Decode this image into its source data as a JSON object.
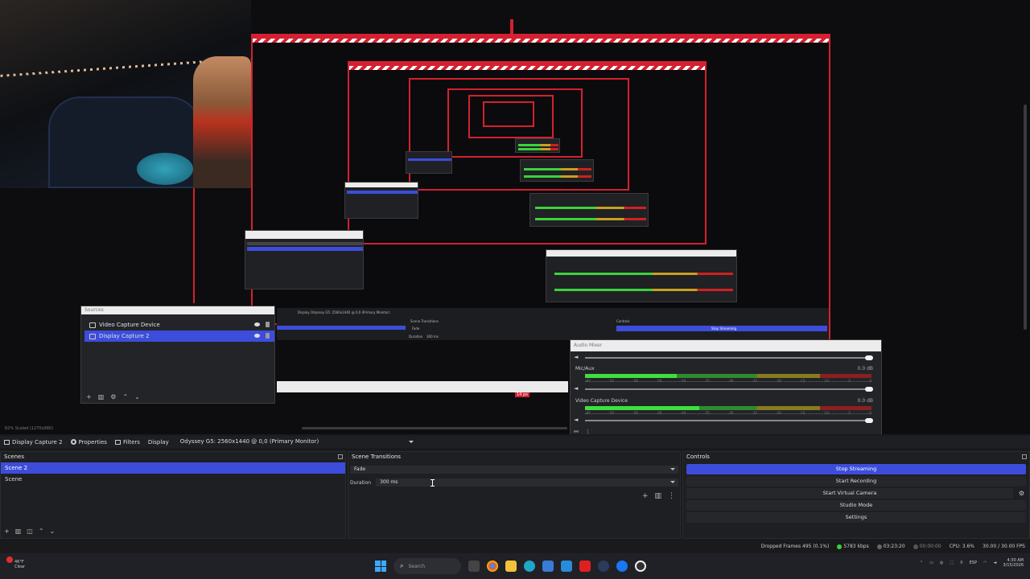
{
  "preview": {
    "sources_window": {
      "title": "Sources",
      "items": [
        {
          "label": "Video Capture Device",
          "selected": false
        },
        {
          "label": "Display Capture 2",
          "selected": true
        }
      ]
    },
    "audio_window": {
      "title": "Audio Mixer",
      "channels": [
        {
          "name": "Mic/Aux",
          "db": "0.0 dB",
          "level": 0.32
        },
        {
          "name": "Video Capture Device",
          "db": "0.0 dB",
          "level": 0.4
        }
      ],
      "ticks": [
        "-60",
        "-55",
        "-50",
        "-45",
        "-40",
        "-35",
        "-30",
        "-25",
        "-20",
        "-15",
        "-10",
        "-5",
        "0"
      ]
    },
    "nested_labels": {
      "display": "Display",
      "display_value": "Odyssey G5: 2560x1440 @ 0,0 (Primary Monitor)",
      "scene_transitions": "Scene Transitions",
      "fade": "Fade",
      "duration": "Duration",
      "duration_value": "300 ms",
      "controls": "Controls",
      "stop_streaming": "Stop Streaming",
      "start_recording": "Start Recording",
      "px_label": "14 px"
    },
    "status_small": "62%   Scaled (1270x980)"
  },
  "context_bar": {
    "source_name": "Display Capture 2",
    "properties": "Properties",
    "filters": "Filters",
    "display_label": "Display",
    "display_value": "Odyssey G5: 2560x1440 @ 0,0 (Primary Monitor)"
  },
  "scenes": {
    "title": "Scenes",
    "items": [
      {
        "label": "Scene 2",
        "selected": true
      },
      {
        "label": "Scene",
        "selected": false
      }
    ]
  },
  "transitions": {
    "title": "Scene Transitions",
    "transition": "Fade",
    "duration_label": "Duration",
    "duration_value": "300 ms"
  },
  "controls": {
    "title": "Controls",
    "buttons": [
      {
        "label": "Stop Streaming",
        "active": true
      },
      {
        "label": "Start Recording",
        "active": false
      },
      {
        "label": "Start Virtual Camera",
        "active": false
      },
      {
        "label": "Studio Mode",
        "active": false
      },
      {
        "label": "Settings",
        "active": false
      }
    ]
  },
  "statusbar": {
    "dropped": "Dropped Frames 495 (0.1%)",
    "bitrate": "5783 kbps",
    "live_time": "03:23:20",
    "rec_time": "00:00:00",
    "cpu": "CPU: 3.6%",
    "fps": "30.00 / 30.00 FPS"
  },
  "taskbar": {
    "weather_temp": "46°F",
    "weather_desc": "Clear",
    "search_placeholder": "Search",
    "lang": "ESP",
    "time": "4:30 AM",
    "date": "3/15/2026"
  },
  "colors": {
    "accent": "#3d4ddb",
    "live_red": "#d42030",
    "meter_green": "#3ee03e"
  }
}
